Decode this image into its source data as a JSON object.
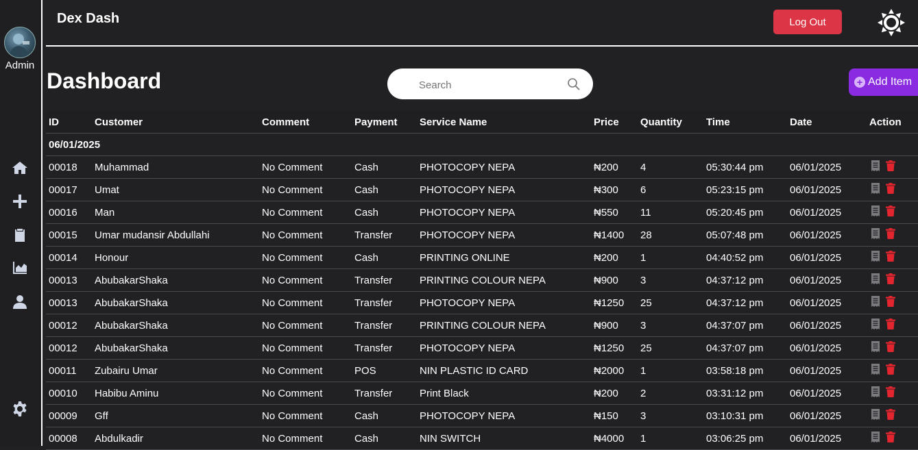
{
  "sidebar": {
    "user_label": "Admin"
  },
  "header": {
    "brand": "Dex Dash",
    "logout_label": "Log Out"
  },
  "main": {
    "title": "Dashboard",
    "search_placeholder": "Search",
    "add_item_label": "Add Item"
  },
  "table": {
    "columns": [
      "ID",
      "Customer",
      "Comment",
      "Payment",
      "Service Name",
      "Price",
      "Quantity",
      "Time",
      "Date",
      "Action"
    ],
    "group_date": "06/01/2025",
    "rows": [
      {
        "id": "00018",
        "customer": "Muhammad",
        "comment": "No Comment",
        "payment": "Cash",
        "service": "PHOTOCOPY NEPA",
        "price": "₦200",
        "quantity": "4",
        "time": "05:30:44 pm",
        "date": "06/01/2025"
      },
      {
        "id": "00017",
        "customer": "Umat",
        "comment": "No Comment",
        "payment": "Cash",
        "service": "PHOTOCOPY NEPA",
        "price": "₦300",
        "quantity": "6",
        "time": "05:23:15 pm",
        "date": "06/01/2025"
      },
      {
        "id": "00016",
        "customer": "Man",
        "comment": "No Comment",
        "payment": "Cash",
        "service": "PHOTOCOPY NEPA",
        "price": "₦550",
        "quantity": "11",
        "time": "05:20:45 pm",
        "date": "06/01/2025"
      },
      {
        "id": "00015",
        "customer": "Umar mudansir Abdullahi",
        "comment": "No Comment",
        "payment": "Transfer",
        "service": "PHOTOCOPY NEPA",
        "price": "₦1400",
        "quantity": "28",
        "time": "05:07:48 pm",
        "date": "06/01/2025"
      },
      {
        "id": "00014",
        "customer": "Honour",
        "comment": "No Comment",
        "payment": "Cash",
        "service": "PRINTING ONLINE",
        "price": "₦200",
        "quantity": "1",
        "time": "04:40:52 pm",
        "date": "06/01/2025"
      },
      {
        "id": "00013",
        "customer": "AbubakarShaka",
        "comment": "No Comment",
        "payment": "Transfer",
        "service": "PRINTING COLOUR NEPA",
        "price": "₦900",
        "quantity": "3",
        "time": "04:37:12 pm",
        "date": "06/01/2025"
      },
      {
        "id": "00013",
        "customer": "AbubakarShaka",
        "comment": "No Comment",
        "payment": "Transfer",
        "service": "PHOTOCOPY NEPA",
        "price": "₦1250",
        "quantity": "25",
        "time": "04:37:12 pm",
        "date": "06/01/2025"
      },
      {
        "id": "00012",
        "customer": "AbubakarShaka",
        "comment": "No Comment",
        "payment": "Transfer",
        "service": "PRINTING COLOUR NEPA",
        "price": "₦900",
        "quantity": "3",
        "time": "04:37:07 pm",
        "date": "06/01/2025"
      },
      {
        "id": "00012",
        "customer": "AbubakarShaka",
        "comment": "No Comment",
        "payment": "Transfer",
        "service": "PHOTOCOPY NEPA",
        "price": "₦1250",
        "quantity": "25",
        "time": "04:37:07 pm",
        "date": "06/01/2025"
      },
      {
        "id": "00011",
        "customer": "Zubairu Umar",
        "comment": "No Comment",
        "payment": "POS",
        "service": "NIN PLASTIC ID CARD",
        "price": "₦2000",
        "quantity": "1",
        "time": "03:58:18 pm",
        "date": "06/01/2025"
      },
      {
        "id": "00010",
        "customer": "Habibu Aminu",
        "comment": "No Comment",
        "payment": "Transfer",
        "service": "Print Black",
        "price": "₦200",
        "quantity": "2",
        "time": "03:31:12 pm",
        "date": "06/01/2025"
      },
      {
        "id": "00009",
        "customer": "Gff",
        "comment": "No Comment",
        "payment": "Cash",
        "service": "PHOTOCOPY NEPA",
        "price": "₦150",
        "quantity": "3",
        "time": "03:10:31 pm",
        "date": "06/01/2025"
      },
      {
        "id": "00008",
        "customer": "Abdulkadir",
        "comment": "No Comment",
        "payment": "Cash",
        "service": "NIN SWITCH",
        "price": "₦4000",
        "quantity": "1",
        "time": "03:06:25 pm",
        "date": "06/01/2025"
      }
    ]
  },
  "colors": {
    "background": "#212124",
    "logout": "#dc3545",
    "add_item": "#8a2be2",
    "delete": "#e3252f",
    "receipt": "#7a7a7f",
    "nav_icon": "#cfd6e6"
  }
}
